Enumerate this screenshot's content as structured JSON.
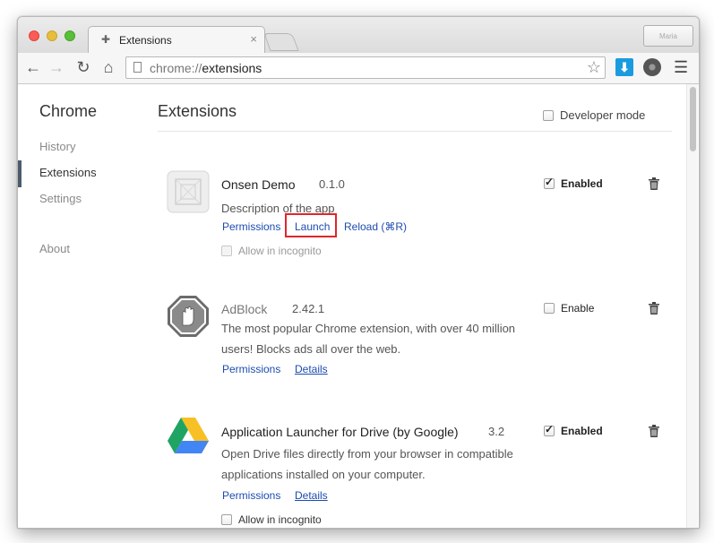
{
  "window": {
    "tab_title": "Extensions",
    "tab_close": "×",
    "profile_label": "Maria"
  },
  "toolbar": {
    "url_scheme": "chrome://",
    "url_path": "extensions"
  },
  "sidebar": {
    "title": "Chrome",
    "items": [
      {
        "label": "History"
      },
      {
        "label": "Extensions"
      },
      {
        "label": "Settings"
      },
      {
        "label": "About"
      }
    ]
  },
  "main": {
    "title": "Extensions",
    "developer_mode_label": "Developer mode"
  },
  "extensions": [
    {
      "name": "Onsen Demo",
      "version": "0.1.0",
      "description": "Description of the app",
      "links": [
        "Permissions",
        "Launch",
        "Reload (⌘R)"
      ],
      "incognito_label": "Allow in incognito",
      "enable_label": "Enabled",
      "enabled": true
    },
    {
      "name": "AdBlock",
      "version": "2.42.1",
      "description_line1": "The most popular Chrome extension, with over 40 million",
      "description_line2": "users! Blocks ads all over the web.",
      "links": [
        "Permissions",
        "Details"
      ],
      "enable_label": "Enable",
      "enabled": false
    },
    {
      "name": "Application Launcher for Drive (by Google)",
      "version": "3.2",
      "description_line1": "Open Drive files directly from your browser in compatible",
      "description_line2": "applications installed on your computer.",
      "links": [
        "Permissions",
        "Details"
      ],
      "incognito_label": "Allow in incognito",
      "enable_label": "Enabled",
      "enabled": true
    }
  ],
  "colors": {
    "link": "#1c4cb0",
    "highlight_box": "#e0262a",
    "close_light": "#fc5b57",
    "minimize_light": "#e5bf3c",
    "zoom_light": "#57c038"
  }
}
